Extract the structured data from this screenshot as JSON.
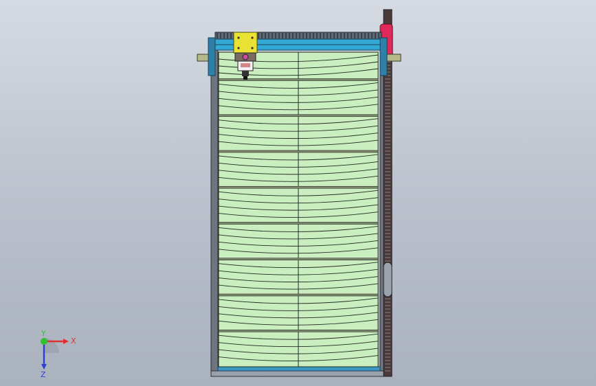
{
  "viewport": {
    "background_top": "#d6dbe3",
    "background_bottom": "#aab2be",
    "colors": {
      "frame": "#3d3d3d",
      "panel_fill": "#cbeec0",
      "panel_line": "#1f2a1f",
      "rail_blue": "#34a9d6",
      "carriage_yellow": "#e9e232",
      "rack_red": "#e0295a",
      "rack_dark": "#4a3b3b",
      "shaft_tan": "#b7b88a",
      "bottom_bar": "#3b98c7"
    },
    "panel_sections": 8,
    "arc_lines_per_section": 4
  },
  "triad": {
    "x_label": "X",
    "y_label": "Y",
    "z_label": "Z",
    "x_color": "#e03030",
    "y_color": "#30c030",
    "z_color": "#3040d0"
  }
}
